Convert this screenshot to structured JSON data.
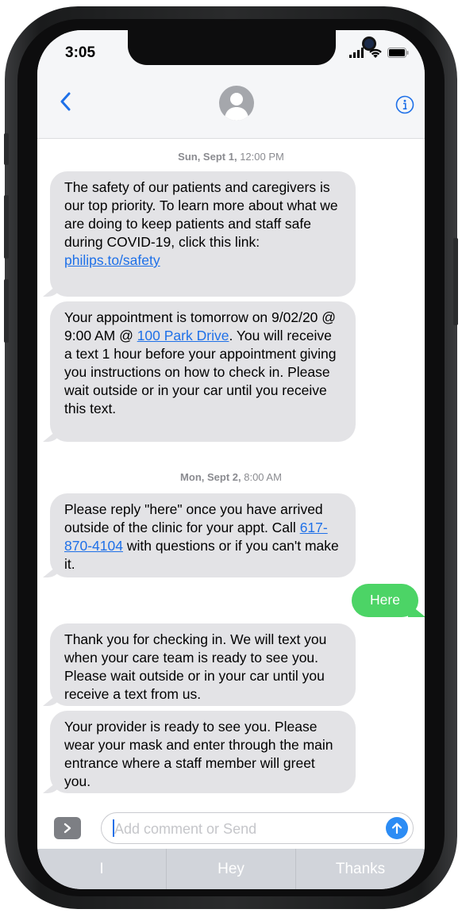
{
  "status_bar": {
    "time": "3:05"
  },
  "header": {
    "back_icon": "chevron-left-icon",
    "avatar_icon": "person-icon",
    "info_icon": "info-icon",
    "accent": "#1e70e8"
  },
  "thread": {
    "stamps": [
      {
        "day": "Sun, Sept 1,",
        "time": "12:00 PM"
      },
      {
        "day": "Mon, Sept 2,",
        "time": "8:00 AM"
      }
    ],
    "messages": [
      {
        "pre": "The safety of our patients and caregivers is our top priority. To learn more about what we are doing to keep patients and staff safe during COVID-19, click this link:",
        "link": "philips.to/safety",
        "post": ""
      },
      {
        "pre": "Your appointment is tomorrow on 9/02/20 @ 9:00 AM @ ",
        "link": "100 Park Drive",
        "post": ". You will receive a text 1 hour before your appointment giving you instructions on how to check in. Please wait outside or in your car until you receive this text."
      },
      {
        "pre": "Please reply \"here\" once you have arrived outside of the clinic for your appt. Call ",
        "link": "617-870-4104",
        "post": " with questions or if you can't make it."
      },
      {
        "text": "Here"
      },
      {
        "text": "Thank you for checking in. We will text you when your care team is ready to see you. Please wait outside or in your car until you receive a text from us."
      },
      {
        "text": "Your provider is ready to see you. Please wear your mask and enter through the main entrance where a staff member will greet you."
      }
    ]
  },
  "composer": {
    "placeholder": "Add comment or Send",
    "value": ""
  },
  "suggestions": [
    "I",
    "Hey",
    "Thanks"
  ],
  "colors": {
    "incoming": "#e3e3e6",
    "outgoing": "#4cd466",
    "link": "#1e70e8"
  }
}
